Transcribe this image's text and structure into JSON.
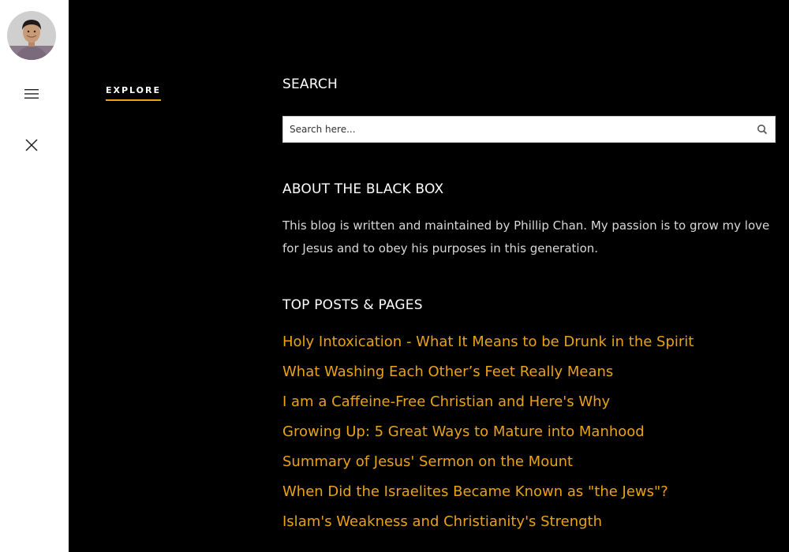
{
  "sidebar": {
    "avatar_alt": "Phillip Chan avatar"
  },
  "nav": {
    "explore_label": "EXPLORE"
  },
  "search": {
    "title": "SEARCH",
    "placeholder": "Search here..."
  },
  "about": {
    "title": "ABOUT THE BLACK BOX",
    "text": "This blog is written and maintained by Phillip Chan. My passion is to grow my love for Jesus and to obey his purposes in this generation."
  },
  "top_posts": {
    "title": "TOP POSTS & PAGES",
    "items": [
      {
        "label": "Holy Intoxication - What It Means to be Drunk in the Spirit"
      },
      {
        "label": "What Washing Each Other’s Feet Really Means"
      },
      {
        "label": "I am a Caffeine-Free Christian and Here's Why"
      },
      {
        "label": "Growing Up: 5 Great Ways to Mature into Manhood"
      },
      {
        "label": "Summary of Jesus' Sermon on the Mount"
      },
      {
        "label": "When Did the Israelites Became Known as \"the Jews\"?"
      },
      {
        "label": "Islam's Weakness and Christianity's Strength"
      }
    ]
  },
  "colors": {
    "accent": "#e8a317",
    "background": "#000000",
    "sidebar": "#ffffff"
  },
  "icons": [
    "menu-icon",
    "close-icon",
    "search-icon"
  ]
}
